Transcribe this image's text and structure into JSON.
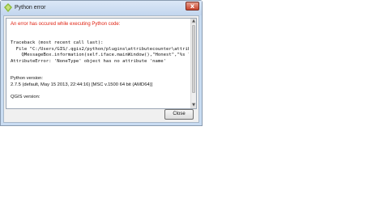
{
  "window": {
    "title": "Python error",
    "close_glyph": "x"
  },
  "error": {
    "header": "An error has occured while executing Python code:",
    "traceback_lines": [
      "Traceback (most recent call last):",
      "  File \"C:/Users/GIS/.qgis2/python/plugins\\attributecounter\\attrib",
      "    QMessageBox.information(self.iface.mainWindow(),\"Honest\",\"%s l",
      "AttributeError: 'NoneType' object has no attribute 'name'"
    ],
    "python_version_label": "Python version:",
    "python_version_value": "2.7.5 (default, May 15 2013, 22:44:16) [MSC v.1500 64 bit (AMD64)]",
    "qgis_version_label": "QGIS version:"
  },
  "scrollbar": {
    "up_glyph": "▲",
    "down_glyph": "▼"
  },
  "buttons": {
    "close_label": "Close"
  },
  "colors": {
    "error_text": "#e02010",
    "title_bar": "#c9dcf2"
  }
}
